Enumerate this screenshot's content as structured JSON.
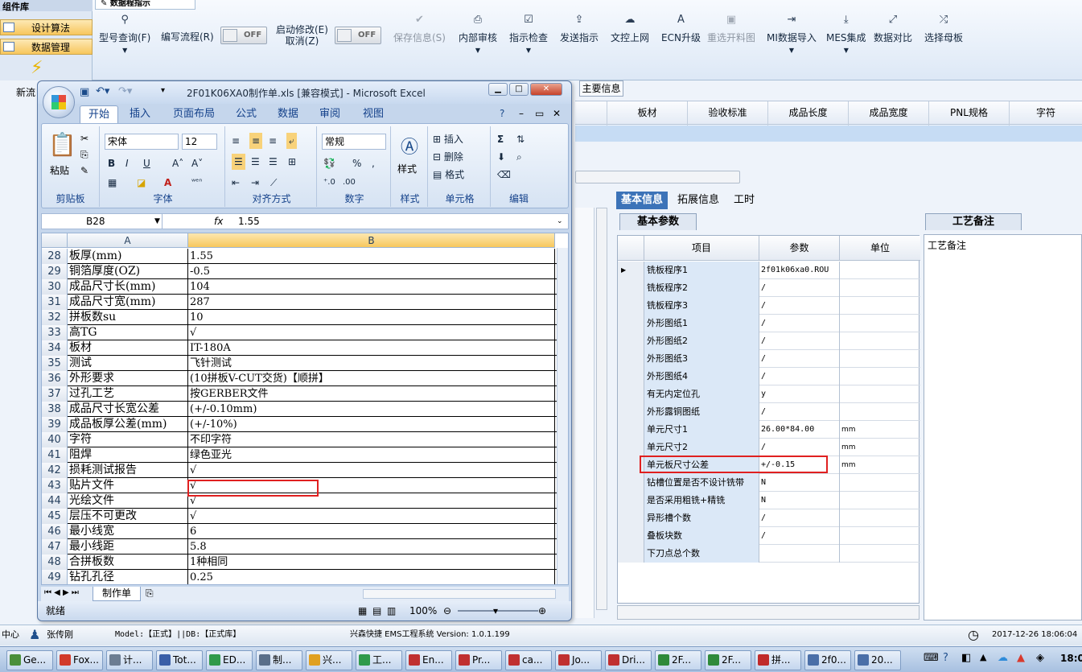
{
  "sidebar": {
    "title": "组件库",
    "items": [
      {
        "label": "设计算法"
      },
      {
        "label": "数据管理"
      }
    ],
    "new_label": "新流"
  },
  "doc_tab": {
    "label": "数据程指示"
  },
  "toolbar": {
    "items": [
      {
        "label": "型号查询(F)",
        "icon": "search-icon",
        "disabled": false
      },
      {
        "label": "编写流程(R)",
        "icon": "",
        "disabled": false
      },
      {
        "label": "启动修改(E)",
        "label2": "取消(Z)",
        "disabled": false
      },
      {
        "label": "保存信息(S)",
        "icon": "check-icon",
        "disabled": true
      },
      {
        "label": "内部审核",
        "icon": "printer-icon",
        "disabled": false
      },
      {
        "label": "指示检查",
        "icon": "checkbox-icon",
        "disabled": false
      },
      {
        "label": "发送指示",
        "icon": "upload-icon",
        "disabled": false
      },
      {
        "label": "文控上网",
        "icon": "cloud-upload-icon",
        "disabled": false
      },
      {
        "label": "ECN升级",
        "icon": "font-icon",
        "disabled": false
      },
      {
        "label": "重选开料图",
        "icon": "image-icon",
        "disabled": true
      },
      {
        "label": "MI数据导入",
        "icon": "import-icon",
        "disabled": false
      },
      {
        "label": "MES集成",
        "icon": "download-icon",
        "disabled": false
      },
      {
        "label": "数据对比",
        "icon": "compare-icon",
        "disabled": false
      },
      {
        "label": "选择母板",
        "icon": "shuffle-icon",
        "disabled": false
      }
    ],
    "toggle1": "OFF",
    "toggle2": "OFF"
  },
  "main": {
    "tab_label": "主要信息",
    "columns": [
      "板材",
      "验收标准",
      "成品长度",
      "成品宽度",
      "PNL规格",
      "字符"
    ]
  },
  "info": {
    "tabs": [
      "基本信息",
      "拓展信息",
      "工时"
    ],
    "subtab": "基本参数",
    "headers": [
      "项目",
      "参数",
      "单位"
    ],
    "rows": [
      {
        "item": "铣板程序1",
        "value": "2f01k06xa0.ROU",
        "unit": ""
      },
      {
        "item": "铣板程序2",
        "value": "/",
        "unit": ""
      },
      {
        "item": "铣板程序3",
        "value": "/",
        "unit": ""
      },
      {
        "item": "外形图纸1",
        "value": "/",
        "unit": ""
      },
      {
        "item": "外形图纸2",
        "value": "/",
        "unit": ""
      },
      {
        "item": "外形图纸3",
        "value": "/",
        "unit": ""
      },
      {
        "item": "外形图纸4",
        "value": "/",
        "unit": ""
      },
      {
        "item": "有无内定位孔",
        "value": "y",
        "unit": ""
      },
      {
        "item": "外形露铜图纸",
        "value": "/",
        "unit": ""
      },
      {
        "item": "单元尺寸1",
        "value": "26.00*84.00",
        "unit": "mm"
      },
      {
        "item": "单元尺寸2",
        "value": "/",
        "unit": "mm"
      },
      {
        "item": "单元板尺寸公差",
        "value": "+/-0.15",
        "unit": "mm"
      },
      {
        "item": "钻槽位置是否不设计铣带",
        "value": "N",
        "unit": ""
      },
      {
        "item": "是否采用粗铣+精铣",
        "value": "N",
        "unit": ""
      },
      {
        "item": "异形槽个数",
        "value": "/",
        "unit": ""
      },
      {
        "item": "叠板块数",
        "value": "/",
        "unit": ""
      },
      {
        "item": "下刀点总个数",
        "value": "",
        "unit": ""
      }
    ]
  },
  "notes": {
    "tab": "工艺备注",
    "label": "工艺备注"
  },
  "status": {
    "left": "中心",
    "user": "张传刚",
    "model": "Model:【正式】||DB:【正式库】",
    "system": "兴森快捷 EMS工程系统 Version: 1.0.1.199",
    "datetime": "2017-12-26 18:06:04"
  },
  "excel": {
    "title": "2F01K06XA0制作单.xls  [兼容模式] - Microsoft Excel",
    "tabs": [
      "开始",
      "插入",
      "页面布局",
      "公式",
      "数据",
      "审阅",
      "视图"
    ],
    "groups": [
      "剪贴板",
      "字体",
      "对齐方式",
      "数字",
      "样式",
      "单元格",
      "编辑"
    ],
    "paste": "粘贴",
    "font_name": "宋体",
    "font_size": "12",
    "number_format": "常规",
    "style_label": "样式",
    "cell_insert": "插入",
    "cell_delete": "删除",
    "cell_format": "格式",
    "name_box": "B28",
    "fx": "fx",
    "formula": "1.55",
    "col_a": "A",
    "col_b": "B",
    "rows": [
      {
        "n": "28",
        "a": "板厚(mm)",
        "b": "1.55"
      },
      {
        "n": "29",
        "a": "铜箔厚度(OZ)",
        "b": "-0.5"
      },
      {
        "n": "30",
        "a": "成品尺寸长(mm)",
        "b": "104"
      },
      {
        "n": "31",
        "a": "成品尺寸宽(mm)",
        "b": "287"
      },
      {
        "n": "32",
        "a": "拼板数su",
        "b": "10"
      },
      {
        "n": "33",
        "a": "高TG",
        "b": "√"
      },
      {
        "n": "34",
        "a": "板材",
        "b": "IT-180A"
      },
      {
        "n": "35",
        "a": "测试",
        "b": "飞针测试"
      },
      {
        "n": "36",
        "a": "外形要求",
        "b": "(10拼板V-CUT交货)【顺拼】"
      },
      {
        "n": "37",
        "a": "过孔工艺",
        "b": "按GERBER文件"
      },
      {
        "n": "38",
        "a": "成品尺寸长宽公差",
        "b": "(+/-0.10mm)"
      },
      {
        "n": "39",
        "a": "成品板厚公差(mm)",
        "b": "(+/-10%)"
      },
      {
        "n": "40",
        "a": "字符",
        "b": "不印字符"
      },
      {
        "n": "41",
        "a": "阻焊",
        "b": "绿色亚光"
      },
      {
        "n": "42",
        "a": "损耗测试报告",
        "b": "√"
      },
      {
        "n": "43",
        "a": "贴片文件",
        "b": "√"
      },
      {
        "n": "44",
        "a": "光绘文件",
        "b": "√"
      },
      {
        "n": "45",
        "a": "层压不可更改",
        "b": "√"
      },
      {
        "n": "46",
        "a": "最小线宽",
        "b": "6"
      },
      {
        "n": "47",
        "a": "最小线距",
        "b": "5.8"
      },
      {
        "n": "48",
        "a": "合拼板数",
        "b": "1种相同"
      },
      {
        "n": "49",
        "a": "钻孔孔径",
        "b": "0.25"
      }
    ],
    "sheet_tab": "制作单",
    "status_ready": "就绪",
    "zoom": "100%"
  },
  "taskbar": {
    "items": [
      "Ge...",
      "Fox...",
      "计...",
      "Tot...",
      "ED...",
      "制...",
      "兴...",
      "工...",
      "En...",
      "Pr...",
      "ca...",
      "Jo...",
      "Dri...",
      "2F...",
      "2F...",
      "拼...",
      "2f0...",
      "20..."
    ],
    "clock": "18:0"
  }
}
